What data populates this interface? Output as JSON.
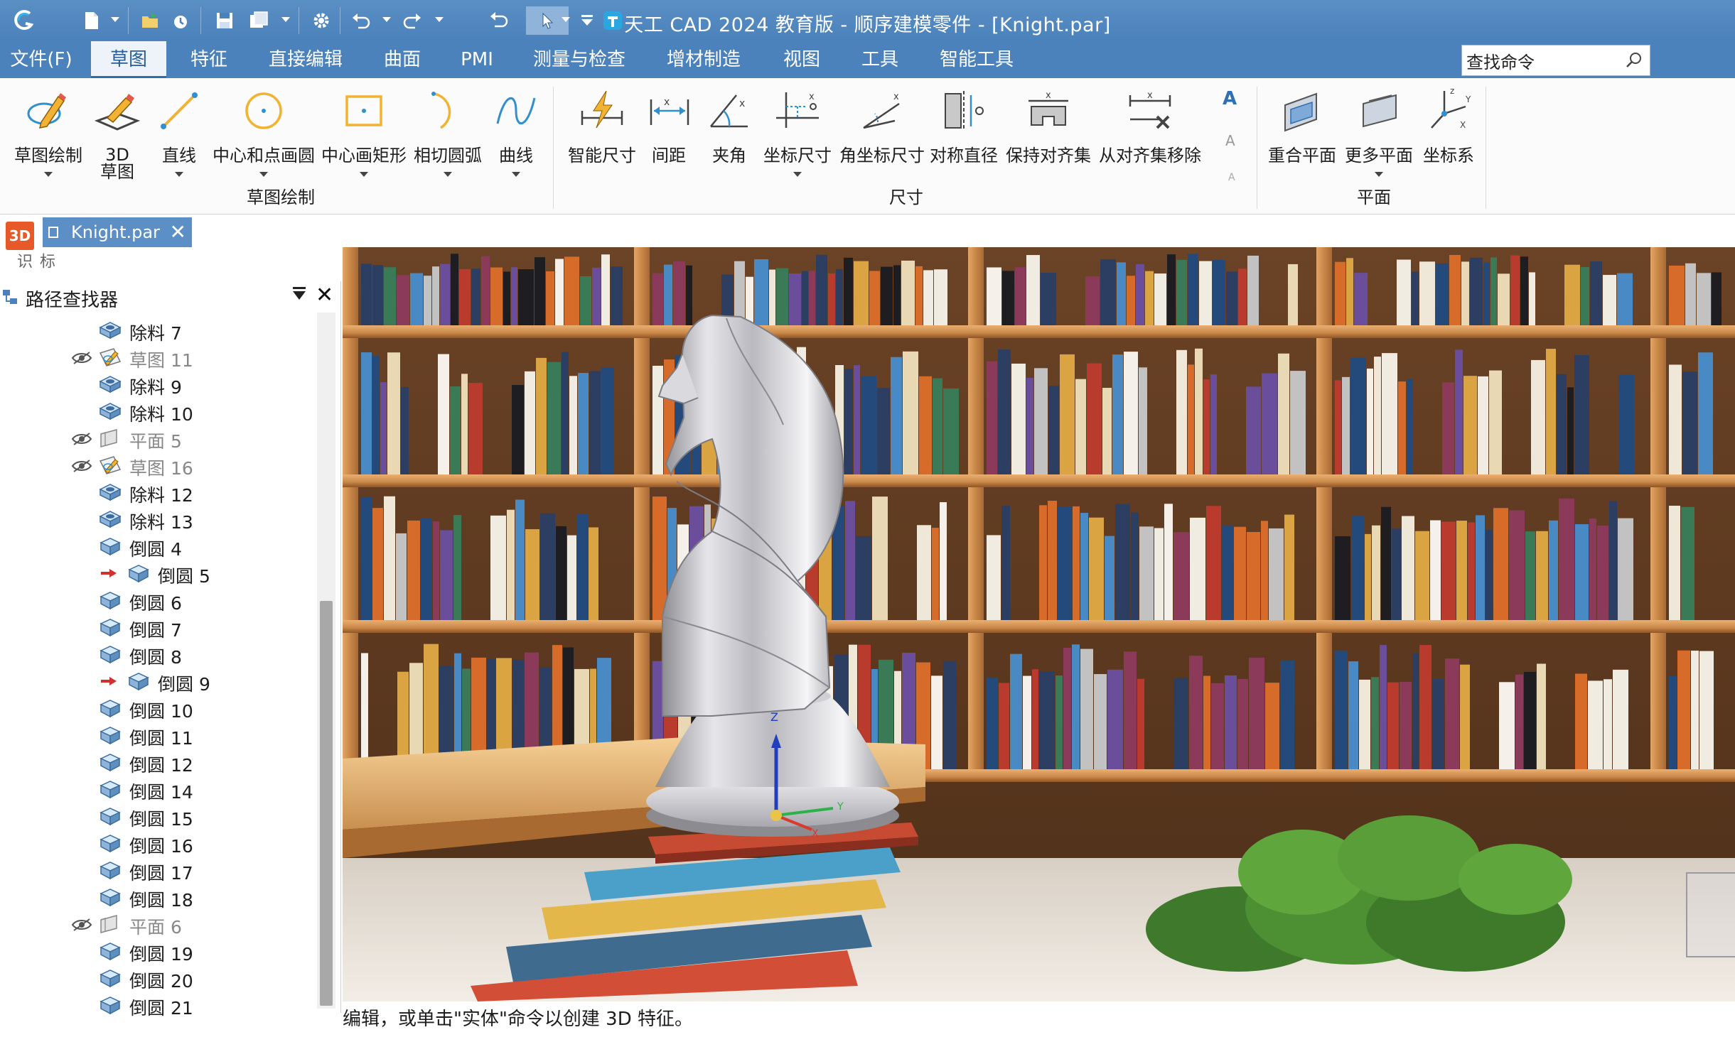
{
  "window": {
    "title": "天工 CAD 2024 教育版 - 顺序建模零件 - [Knight.par]"
  },
  "menu": {
    "items": [
      "文件(F)",
      "草图",
      "特征",
      "直接编辑",
      "曲面",
      "PMI",
      "测量与检查",
      "增材制造",
      "视图",
      "工具",
      "智能工具"
    ],
    "active": "草图"
  },
  "search": {
    "value": "查找命令"
  },
  "ribbon": {
    "sketch_group": {
      "label": "草图绘制",
      "buttons": [
        "草图绘制",
        "3D\n草图",
        "直线",
        "中心和点画圆",
        "中心画矩形",
        "相切圆弧",
        "曲线"
      ]
    },
    "dimension_group": {
      "label": "尺寸",
      "buttons": [
        "智能尺寸",
        "间距",
        "夹角",
        "坐标尺寸",
        "角坐标尺寸",
        "对称直径",
        "保持对齐集",
        "从对齐集移除"
      ]
    },
    "plane_group": {
      "label": "平面",
      "buttons": [
        "重合平面",
        "更多平面",
        "坐标系"
      ]
    }
  },
  "document_tab": {
    "name": "Knight.par"
  },
  "left_strip": {
    "badge": "3D",
    "label": "标识"
  },
  "pathfinder": {
    "title": "路径查找器",
    "rows": [
      {
        "label": "除料 7",
        "kind": "cut",
        "hidden": false,
        "rolled": false
      },
      {
        "label": "草图 11",
        "kind": "sketch",
        "hidden": true,
        "rolled": false
      },
      {
        "label": "除料 9",
        "kind": "cut",
        "hidden": false,
        "rolled": false
      },
      {
        "label": "除料 10",
        "kind": "cut",
        "hidden": false,
        "rolled": false
      },
      {
        "label": "平面 5",
        "kind": "plane",
        "hidden": true,
        "rolled": false
      },
      {
        "label": "草图 16",
        "kind": "sketch",
        "hidden": true,
        "rolled": false
      },
      {
        "label": "除料 12",
        "kind": "cut",
        "hidden": false,
        "rolled": false
      },
      {
        "label": "除料 13",
        "kind": "cut",
        "hidden": false,
        "rolled": false
      },
      {
        "label": "倒圆 4",
        "kind": "round",
        "hidden": false,
        "rolled": false
      },
      {
        "label": "倒圆 5",
        "kind": "round",
        "hidden": false,
        "rolled": true
      },
      {
        "label": "倒圆 6",
        "kind": "round",
        "hidden": false,
        "rolled": false
      },
      {
        "label": "倒圆 7",
        "kind": "round",
        "hidden": false,
        "rolled": false
      },
      {
        "label": "倒圆 8",
        "kind": "round",
        "hidden": false,
        "rolled": false
      },
      {
        "label": "倒圆 9",
        "kind": "round",
        "hidden": false,
        "rolled": true
      },
      {
        "label": "倒圆 10",
        "kind": "round",
        "hidden": false,
        "rolled": false
      },
      {
        "label": "倒圆 11",
        "kind": "round",
        "hidden": false,
        "rolled": false
      },
      {
        "label": "倒圆 12",
        "kind": "round",
        "hidden": false,
        "rolled": false
      },
      {
        "label": "倒圆 14",
        "kind": "round",
        "hidden": false,
        "rolled": false
      },
      {
        "label": "倒圆 15",
        "kind": "round",
        "hidden": false,
        "rolled": false
      },
      {
        "label": "倒圆 16",
        "kind": "round",
        "hidden": false,
        "rolled": false
      },
      {
        "label": "倒圆 17",
        "kind": "round",
        "hidden": false,
        "rolled": false
      },
      {
        "label": "倒圆 18",
        "kind": "round",
        "hidden": false,
        "rolled": false
      },
      {
        "label": "平面 6",
        "kind": "plane",
        "hidden": true,
        "rolled": false
      },
      {
        "label": "倒圆 19",
        "kind": "round",
        "hidden": false,
        "rolled": false
      },
      {
        "label": "倒圆 20",
        "kind": "round",
        "hidden": false,
        "rolled": false
      },
      {
        "label": "倒圆 21",
        "kind": "round",
        "hidden": false,
        "rolled": false
      }
    ]
  },
  "triad": {
    "z": "Z",
    "y": "Y",
    "x": "X"
  },
  "status": {
    "text": "编辑，或单击\"实体\"命令以创建 3D 特征。"
  },
  "colors": {
    "title_bar": "#4b82bb",
    "accent": "#2a6fb3",
    "tab": "#5b8fc6",
    "badge": "#e8592a"
  }
}
